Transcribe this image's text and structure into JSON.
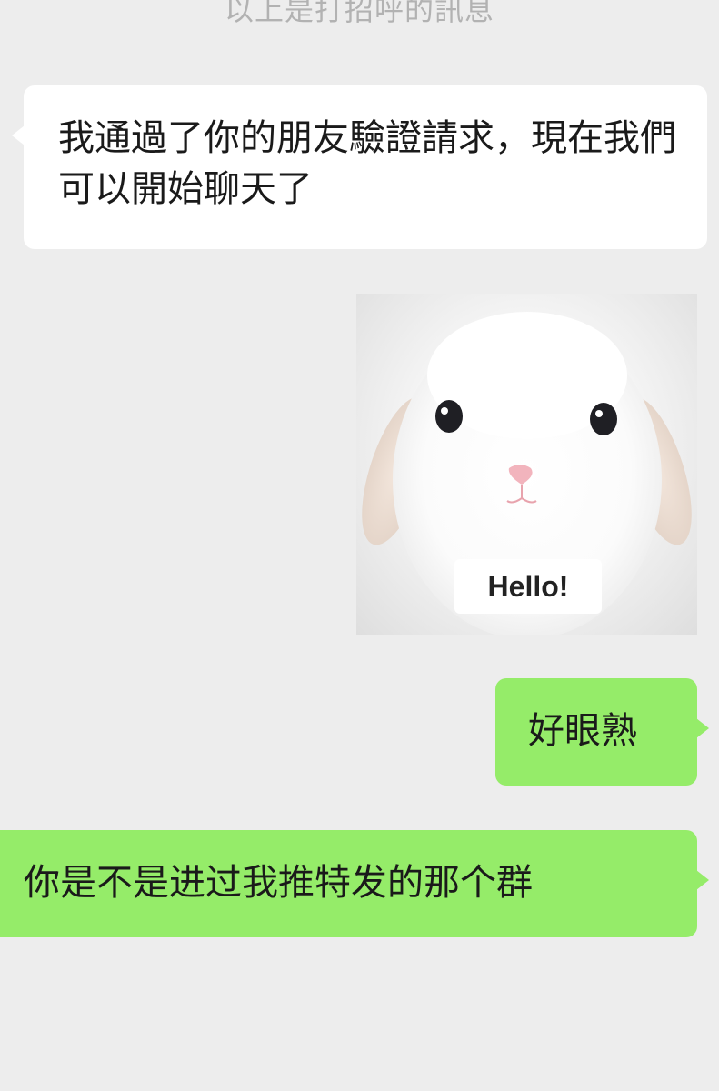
{
  "system_notice": "以上是打招呼的訊息",
  "messages": [
    {
      "direction": "incoming",
      "text": "我通過了你的朋友驗證請求，現在我們可以開始聊天了"
    },
    {
      "direction": "outgoing",
      "type": "sticker",
      "sticker_caption": "Hello!"
    },
    {
      "direction": "outgoing",
      "text": "好眼熟"
    },
    {
      "direction": "outgoing",
      "text": "你是不是进过我推特发的那个群"
    }
  ],
  "colors": {
    "background": "#ededed",
    "incoming_bubble": "#ffffff",
    "outgoing_bubble": "#95ec69",
    "notice_text": "#b2b2b2"
  }
}
